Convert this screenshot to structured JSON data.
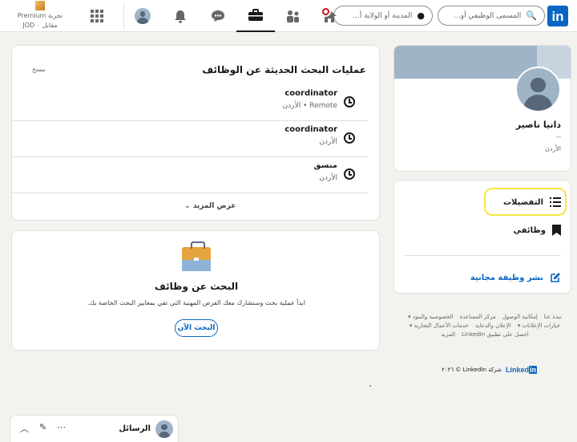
{
  "nav": {
    "search_jobs_placeholder": "المسمى الوظيفي أو...",
    "search_location_placeholder": "المدينة أو الولاية أ...",
    "premium_line1": "تجربة Premium",
    "premium_line2": "مقابل ۰ JOD"
  },
  "profile": {
    "name": "دانيا ناصير",
    "headline": "--",
    "location": "الأردن"
  },
  "side_menu": {
    "preferences": "التفضيلات",
    "my_jobs": "وظائفي",
    "post_job": "نشر وظيفة مجانية"
  },
  "footer_links": [
    "نبذة عنا",
    "إمكانية الوصول",
    "مركز المساعدة",
    "الخصوصية والبنود",
    "خيارات الإعلانات",
    "الإعلان والدعاية",
    "خدمات الأعمال التجارية",
    "احصل على تطبيق LinkedIn",
    "المزيد"
  ],
  "copyright": "شركة LinkedIn © ٢٠٢٦",
  "footer_brand": "Linked",
  "footer_brand_box": "in",
  "recent": {
    "title": "عمليات البحث الحديثة عن الوظائف",
    "clear": "مسح",
    "items": [
      {
        "title": "coordinator",
        "location": "Remote • الأردن"
      },
      {
        "title": "coordinator",
        "location": "الأردن"
      },
      {
        "title": "منسق",
        "location": "الأردن"
      }
    ],
    "show_more": "عرض المزيد"
  },
  "find": {
    "title": "البحث عن وظائف",
    "description": "ابدأ عملية بحث وسنشارك معك الفرص المهنية التي تفي بمعايير البحث الخاصة بك.",
    "button": "البحث الآن"
  },
  "messaging": {
    "label": "الرسائل"
  },
  "colors": {
    "brand": "#0a66c2",
    "notification": "#cc1016",
    "highlight": "#f5e642"
  }
}
